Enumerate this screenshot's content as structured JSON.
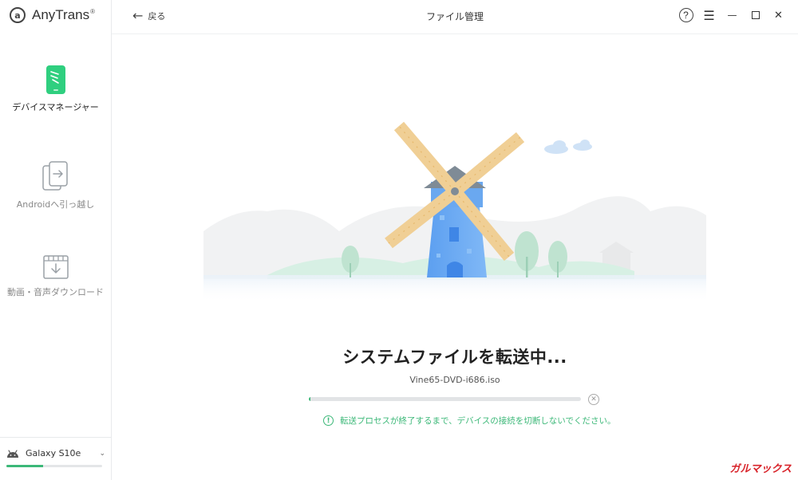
{
  "app": {
    "name": "AnyTrans",
    "reg_mark": "®",
    "logo_letter": "a"
  },
  "sidebar": {
    "items": [
      {
        "label": "デバイスマネージャー",
        "icon": "device-manager-icon",
        "active": true
      },
      {
        "label": "Androidへ引っ越し",
        "icon": "android-switch-icon",
        "active": false
      },
      {
        "label": "動画・音声ダウンロード",
        "icon": "media-download-icon",
        "active": false
      }
    ],
    "device": {
      "name": "Galaxy S10e",
      "icon": "android-robot-icon",
      "storage_used_fraction": 0.38
    }
  },
  "header": {
    "back_label": "戻る",
    "back_arrow": "←",
    "title": "ファイル管理",
    "help_label": "?",
    "menu_glyph": "☰",
    "minimize_glyph": "—",
    "close_glyph": "✕"
  },
  "main": {
    "status_title": "システムファイルを転送中...",
    "file_name": "Vine65-DVD-i686.iso",
    "progress_fraction": 0.005,
    "cancel_glyph": "✕",
    "notice_glyph": "!",
    "notice": "転送プロセスが終了するまで、デバイスの接続を切断しないでください。"
  },
  "watermark": "ガルマックス",
  "colors": {
    "accent": "#3cb878",
    "windmill": "#6aa8f0",
    "blades": "#f5d9a8",
    "watermark": "#d8232a"
  }
}
